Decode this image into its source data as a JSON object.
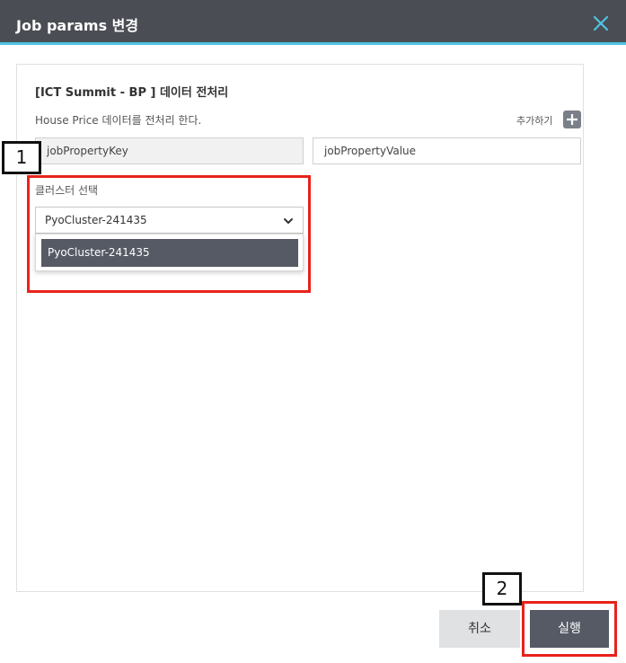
{
  "dialog": {
    "title": "Job params 변경",
    "close_icon": "close-icon"
  },
  "job": {
    "title": "[ICT Summit - BP ] 데이터 전처리",
    "description": "House Price 데이터를 전처리 한다.",
    "add_label": "추가하기"
  },
  "params": {
    "key_value": "jobPropertyKey",
    "value_value": "jobPropertyValue"
  },
  "cluster": {
    "label": "클러스터 선택",
    "selected": "PyoCluster-241435",
    "options": [
      "PyoCluster-241435"
    ]
  },
  "annotations": {
    "badge1": "1",
    "badge2": "2"
  },
  "footer": {
    "cancel_label": "취소",
    "run_label": "실행"
  },
  "colors": {
    "titlebar": "#4a4d54",
    "accent": "#4fc3e0",
    "primary_button": "#555a65",
    "highlight": "#e8221c"
  }
}
